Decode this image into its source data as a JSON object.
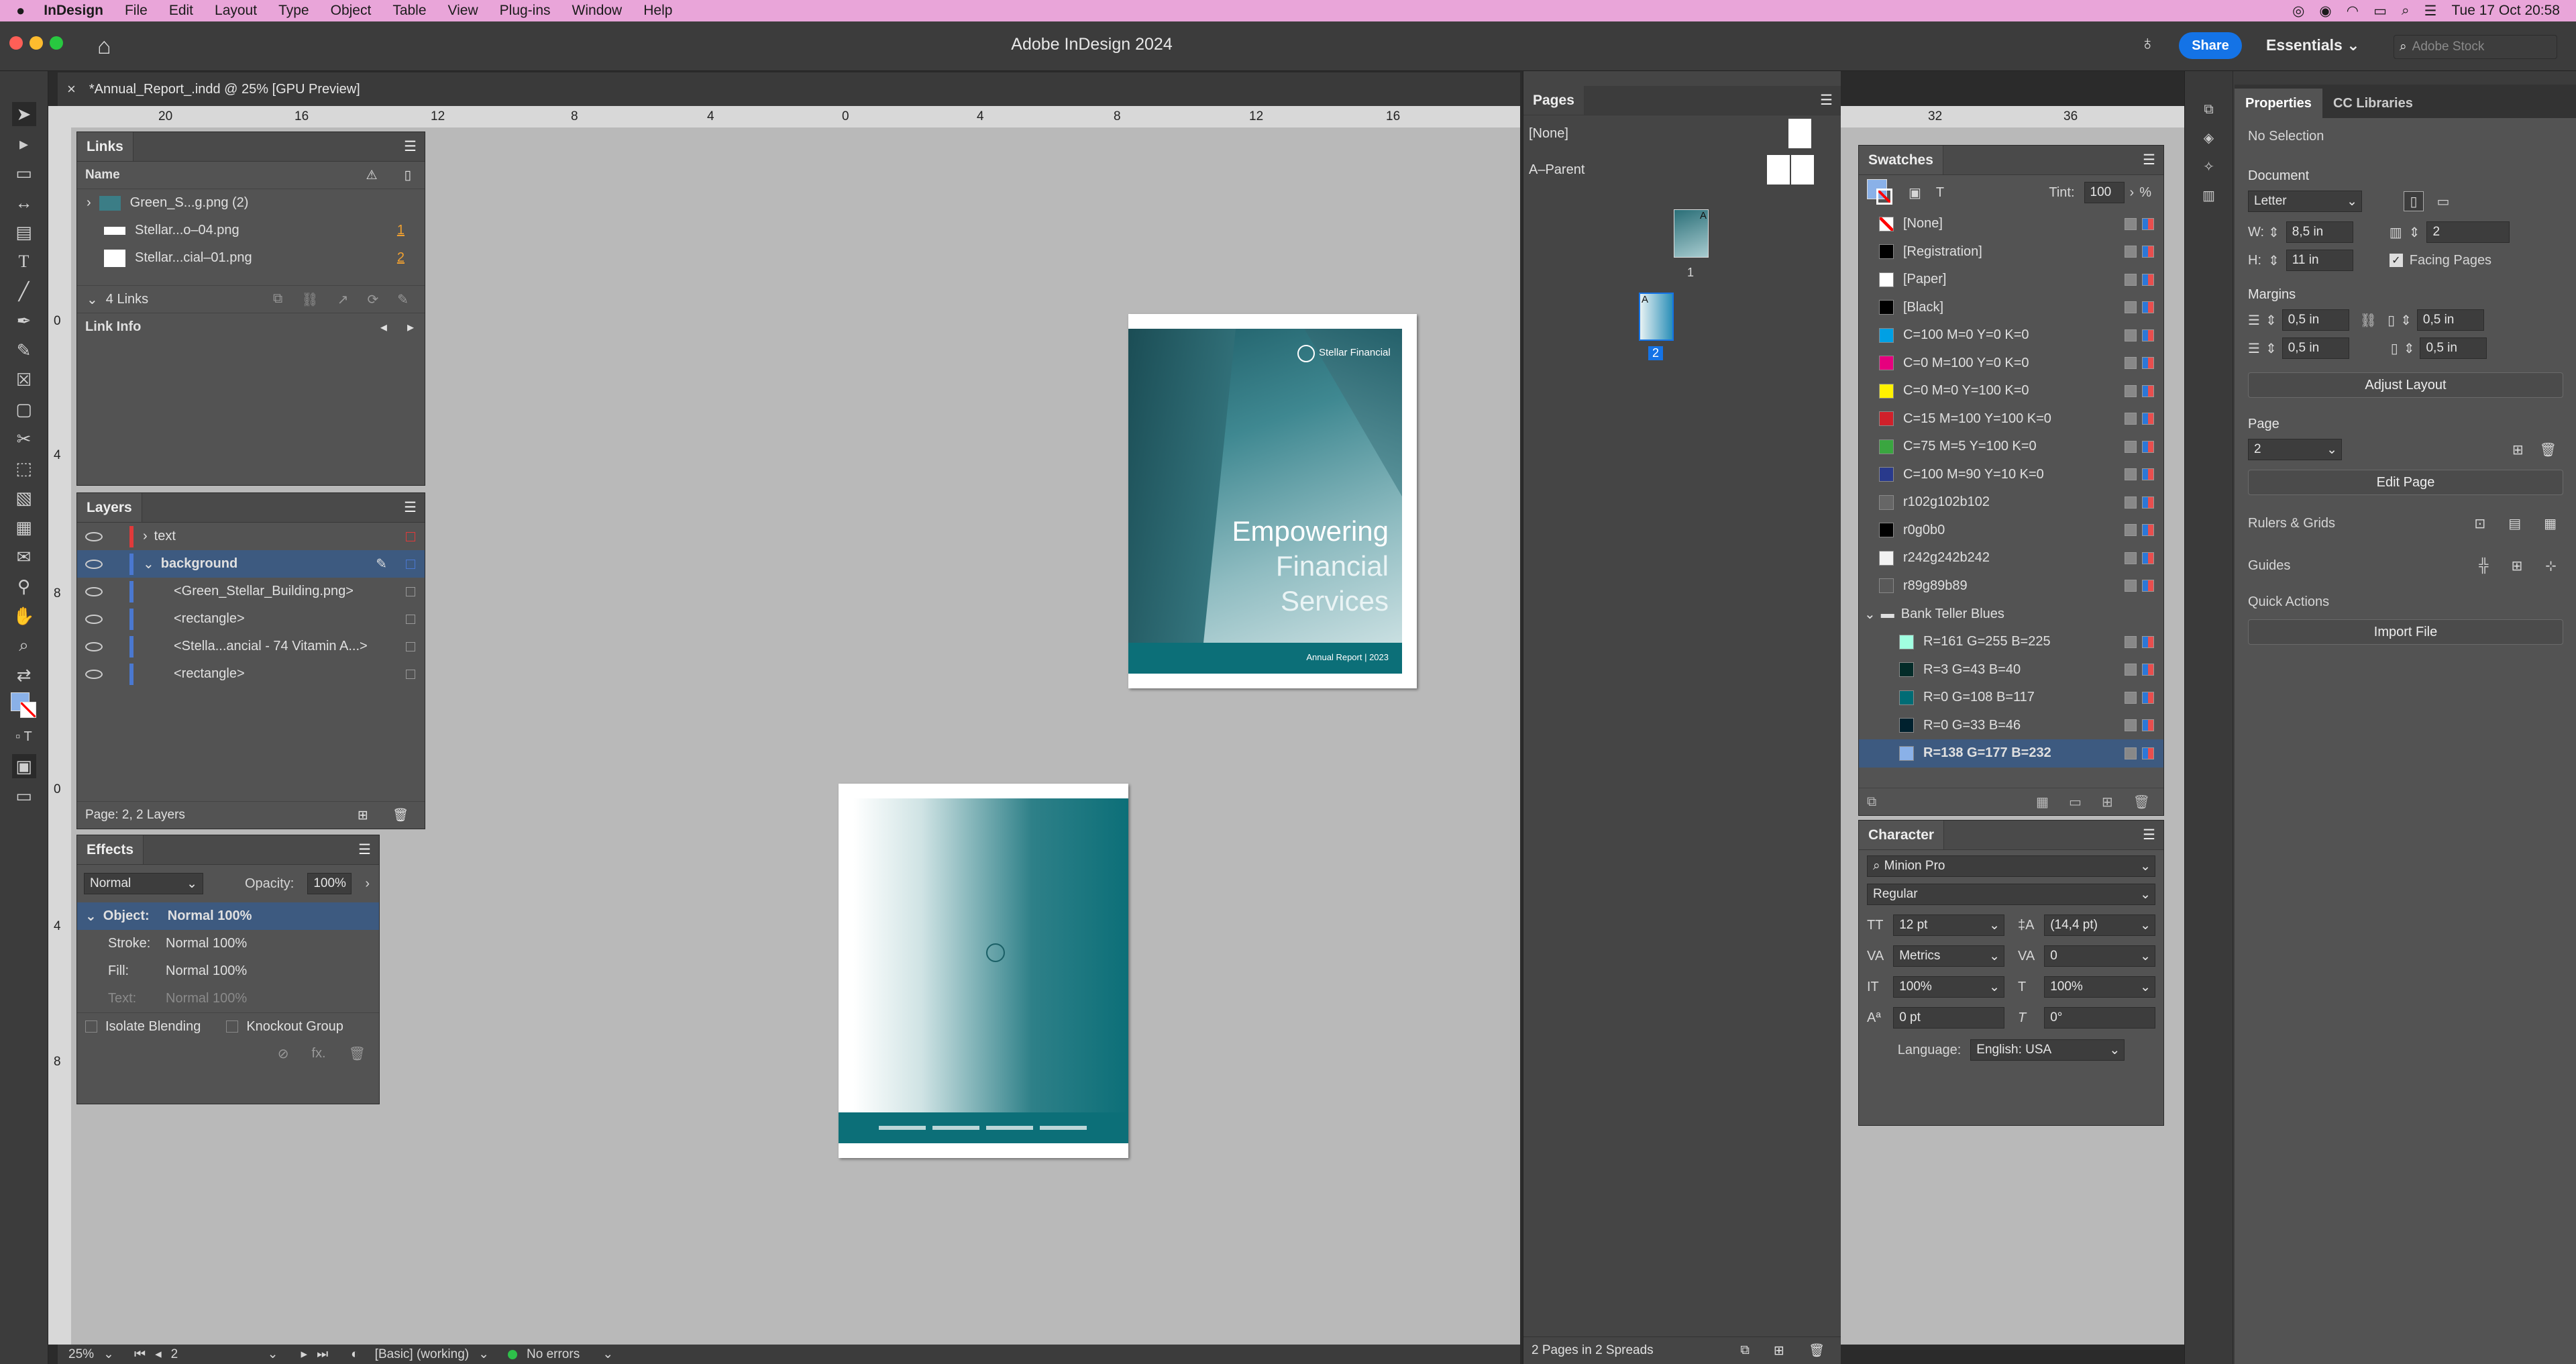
{
  "menubar": {
    "app_name": "InDesign",
    "items": [
      "File",
      "Edit",
      "Layout",
      "Type",
      "Object",
      "Table",
      "View",
      "Plug-ins",
      "Window",
      "Help"
    ],
    "clock": "Tue 17 Oct  20:58"
  },
  "titlebar": {
    "title": "Adobe InDesign 2024",
    "share_label": "Share",
    "workspace_label": "Essentials",
    "stock_placeholder": "Adobe Stock"
  },
  "document_tab": {
    "label": "*Annual_Report_.indd @ 25% [GPU Preview]"
  },
  "ruler": {
    "labels": [
      "20",
      "16",
      "12",
      "8",
      "4",
      "0",
      "4",
      "8",
      "12",
      "16"
    ],
    "right_labels": [
      "32",
      "36"
    ],
    "vertical_labels": [
      "0",
      "4",
      "8",
      "0",
      "4",
      "8"
    ]
  },
  "links_panel": {
    "title": "Links",
    "column_name": "Name",
    "items": [
      {
        "name": "Green_S...g.png (2)",
        "page": ""
      },
      {
        "name": "Stellar...o–04.png",
        "page": "1"
      },
      {
        "name": "Stellar...cial–01.png",
        "page": "2"
      }
    ],
    "count": "4 Links",
    "link_info": "Link Info"
  },
  "layers_panel": {
    "title": "Layers",
    "layers": [
      {
        "name": "text",
        "indent": 0,
        "color": "#e03a3a",
        "selected": false
      },
      {
        "name": "background",
        "indent": 0,
        "color": "#4a78d0",
        "selected": true
      },
      {
        "name": "<Green_Stellar_Building.png>",
        "indent": 1,
        "color": "#4a78d0",
        "selected": false
      },
      {
        "name": "<rectangle>",
        "indent": 1,
        "color": "#4a78d0",
        "selected": false
      },
      {
        "name": "<Stella...ancial - 74 Vitamin A...>",
        "indent": 1,
        "color": "#4a78d0",
        "selected": false
      },
      {
        "name": "<rectangle>",
        "indent": 1,
        "color": "#4a78d0",
        "selected": false
      }
    ],
    "footer": "Page: 2, 2 Layers"
  },
  "effects_panel": {
    "title": "Effects",
    "blend_mode": "Normal",
    "opacity_label": "Opacity:",
    "opacity": "100%",
    "rows": [
      {
        "label": "Object:",
        "value": "Normal 100%"
      },
      {
        "label": "Stroke:",
        "value": "Normal 100%"
      },
      {
        "label": "Fill:",
        "value": "Normal 100%"
      },
      {
        "label": "Text:",
        "value": "Normal 100%"
      }
    ],
    "isolate": "Isolate Blending",
    "knockout": "Knockout Group"
  },
  "pages_panel": {
    "title": "Pages",
    "none_label": "[None]",
    "parent_label": "A–Parent",
    "page1": "1",
    "page2": "2",
    "parent_letter": "A",
    "footer": "2 Pages in 2 Spreads"
  },
  "swatches_panel": {
    "title": "Swatches",
    "tint_label": "Tint:",
    "tint": "100",
    "percent": "%",
    "swatches": [
      {
        "name": "[None]",
        "color": "none"
      },
      {
        "name": "[Registration]",
        "color": "#000000"
      },
      {
        "name": "[Paper]",
        "color": "#ffffff"
      },
      {
        "name": "[Black]",
        "color": "#000000"
      },
      {
        "name": "C=100 M=0 Y=0 K=0",
        "color": "#00a0e4"
      },
      {
        "name": "C=0 M=100 Y=0 K=0",
        "color": "#e6007e"
      },
      {
        "name": "C=0 M=0 Y=100 K=0",
        "color": "#fff200"
      },
      {
        "name": "C=15 M=100 Y=100 K=0",
        "color": "#d0202a"
      },
      {
        "name": "C=75 M=5 Y=100 K=0",
        "color": "#3aa640"
      },
      {
        "name": "C=100 M=90 Y=10 K=0",
        "color": "#293a8c"
      },
      {
        "name": "r102g102b102",
        "color": "#666666"
      },
      {
        "name": "r0g0b0",
        "color": "#000000"
      },
      {
        "name": "r242g242b242",
        "color": "#f2f2f2"
      },
      {
        "name": "r89g89b89",
        "color": "#595959"
      }
    ],
    "group_name": "Bank Teller Blues",
    "group_swatches": [
      {
        "name": "R=161 G=255 B=225",
        "color": "#a1ffe1"
      },
      {
        "name": "R=3 G=43 B=40",
        "color": "#032b28"
      },
      {
        "name": "R=0 G=108 B=117",
        "color": "#006c75"
      },
      {
        "name": "R=0 G=33 B=46",
        "color": "#00212e"
      },
      {
        "name": "R=138 G=177 B=232",
        "color": "#8ab1e8"
      }
    ]
  },
  "character_panel": {
    "title": "Character",
    "font": "Minion Pro",
    "style": "Regular",
    "size": "12 pt",
    "leading": "(14,4 pt)",
    "kerning": "Metrics",
    "tracking": "0",
    "vscale": "100%",
    "hscale": "100%",
    "baseline": "0 pt",
    "skew": "0°",
    "language_label": "Language:",
    "language": "English: USA"
  },
  "properties_panel": {
    "tab_properties": "Properties",
    "tab_cc": "CC Libraries",
    "selection": "No Selection",
    "document_label": "Document",
    "preset": "Letter",
    "w_label": "W:",
    "w": "8,5 in",
    "h_label": "H:",
    "h": "11 in",
    "pages": "2",
    "facing": "Facing Pages",
    "margins_label": "Margins",
    "margin_top": "0,5 in",
    "margin_bottom": "0,5 in",
    "margin_left": "0,5 in",
    "margin_right": "0,5 in",
    "adjust_layout": "Adjust Layout",
    "page_label": "Page",
    "page_value": "2",
    "edit_page": "Edit Page",
    "rulers_label": "Rulers & Grids",
    "guides_label": "Guides",
    "quick_actions": "Quick Actions",
    "import_file": "Import File"
  },
  "cover": {
    "brand": "Stellar Financial",
    "headline1": "Empowering",
    "headline2": "Financial",
    "headline3": "Services",
    "footer": "Annual Report | 2023"
  },
  "statusbar": {
    "zoom": "25%",
    "page": "2",
    "preflight_profile": "[Basic] (working)",
    "errors": "No errors"
  },
  "colors": {
    "teal": "#0c6f78",
    "accent_blue": "#1473e6",
    "selection_blue": "#3d5a80"
  }
}
